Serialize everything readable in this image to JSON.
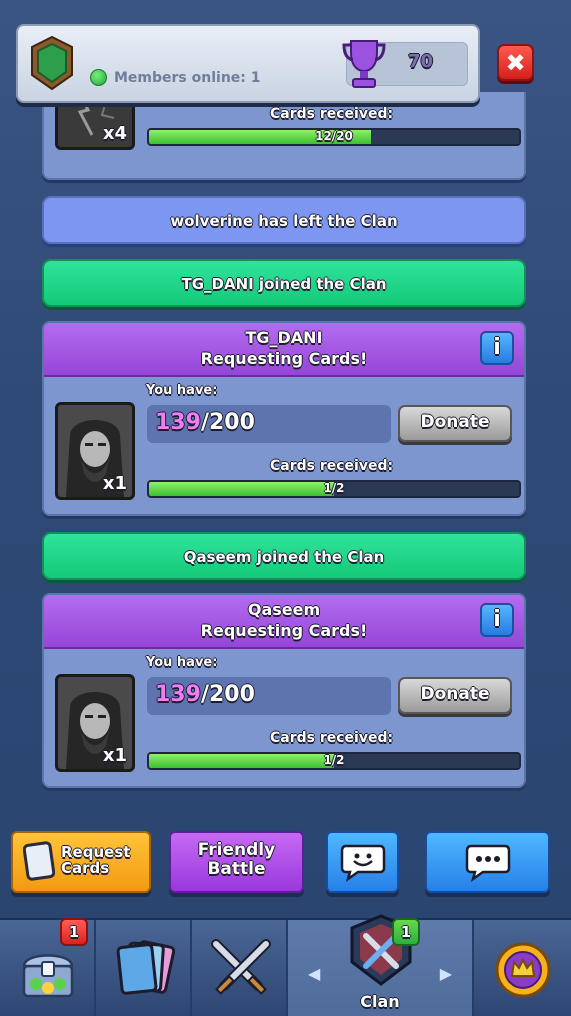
{
  "header": {
    "online_text": "Members online: 1",
    "trophies": "70",
    "close_glyph": "✖"
  },
  "feed": {
    "top_card": {
      "qty": "x4",
      "received_label": "Cards received:",
      "progress_text": "12/20",
      "progress_fraction": 0.6
    },
    "events": [
      {
        "text": "wolverine has left the Clan",
        "style": "blue"
      },
      {
        "text": "TG_DANI joined the Clan",
        "style": "green"
      },
      {
        "text": "Qaseem joined the Clan",
        "style": "green"
      }
    ],
    "requests": [
      {
        "name": "TG_DANI",
        "requesting": "Requesting Cards!",
        "info": "i",
        "you_have_label": "You have:",
        "have_current": "139",
        "have_max": "/200",
        "qty": "x1",
        "donate": "Donate",
        "received_label": "Cards received:",
        "progress_text": "1/2",
        "progress_fraction": 0.5
      },
      {
        "name": "Qaseem",
        "requesting": "Requesting Cards!",
        "info": "i",
        "you_have_label": "You have:",
        "have_current": "139",
        "have_max": "/200",
        "qty": "x1",
        "donate": "Donate",
        "received_label": "Cards received:",
        "progress_text": "1/2",
        "progress_fraction": 0.5
      }
    ]
  },
  "actions": {
    "request_line1": "Request",
    "request_line2": "Cards",
    "friendly_line1": "Friendly",
    "friendly_line2": "Battle"
  },
  "nav": {
    "shop_badge": "1",
    "clan_badge": "1",
    "clan_label": "Clan",
    "arrow_left": "◀",
    "arrow_right": "▶"
  },
  "colors": {
    "event_blue": "#7d96ef",
    "event_green": "#15c97a",
    "request_purple": "#9546d8",
    "progress_green": "#3fbf31"
  }
}
